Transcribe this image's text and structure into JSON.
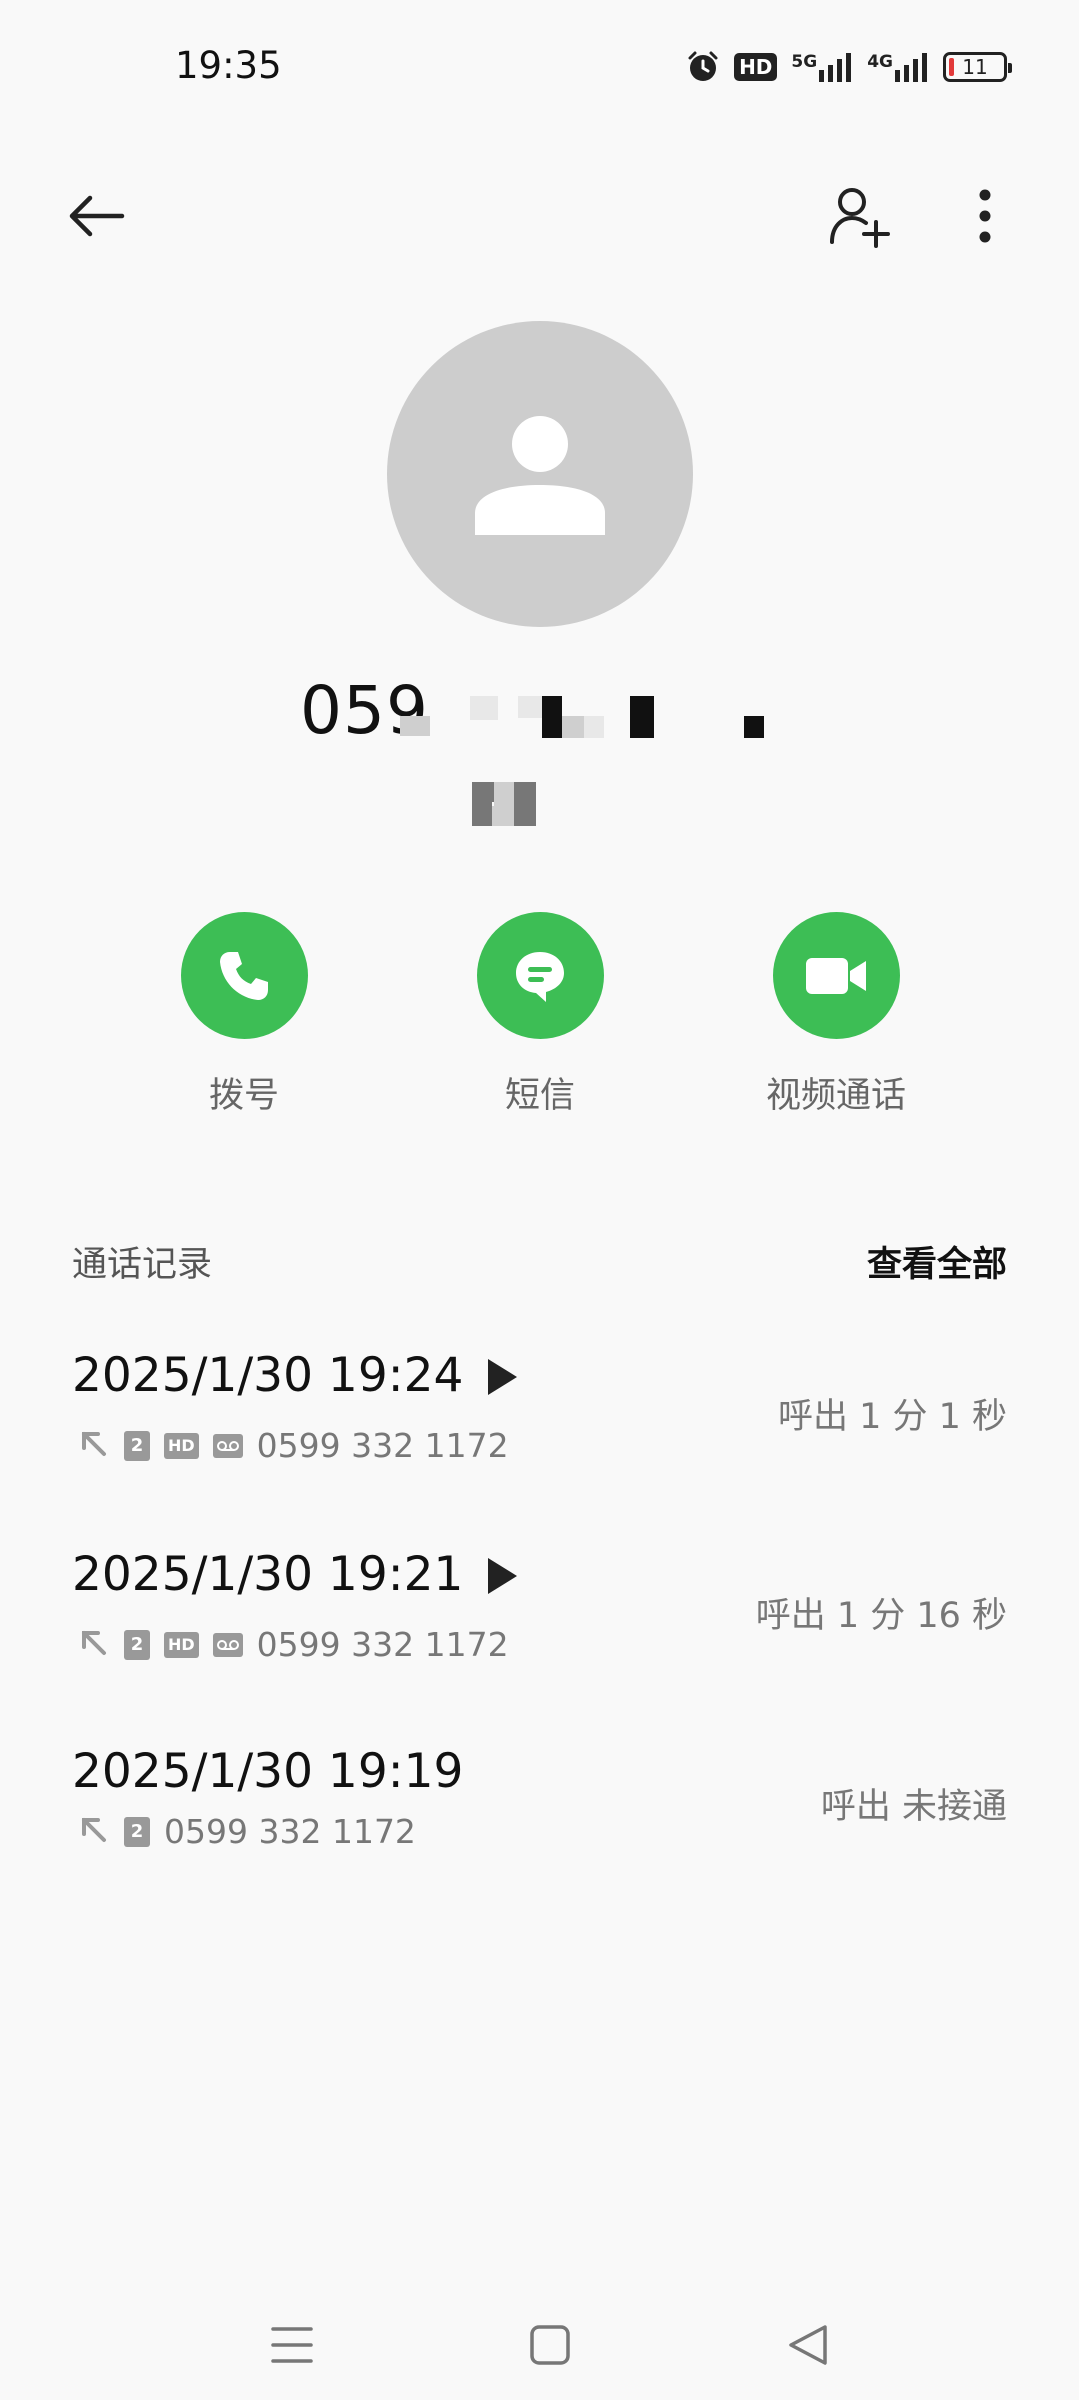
{
  "status_bar": {
    "time": "19:35",
    "hd_label": "HD",
    "net1_label": "5G",
    "net2_label": "4G",
    "battery_level": "11"
  },
  "top_bar": {
    "back_icon": "arrow-left-icon",
    "add_contact_icon": "person-add-icon",
    "more_icon": "more-vertical-icon"
  },
  "contact": {
    "number_visible": "059"
  },
  "actions": [
    {
      "label": "拨号",
      "icon": "phone-icon"
    },
    {
      "label": "短信",
      "icon": "message-icon"
    },
    {
      "label": "视频通话",
      "icon": "video-icon"
    }
  ],
  "call_log": {
    "title": "通话记录",
    "view_all": "查看全部",
    "entries": [
      {
        "datetime": "2025/1/30 19:24",
        "number": "0599 332 1172",
        "status": "呼出  1 分 1 秒",
        "has_recording": true,
        "hd": "HD",
        "sim": "2"
      },
      {
        "datetime": "2025/1/30 19:21",
        "number": "0599 332 1172",
        "status": "呼出  1 分 16 秒",
        "has_recording": true,
        "hd": "HD",
        "sim": "2"
      },
      {
        "datetime": "2025/1/30 19:19",
        "number": "0599 332 1172",
        "status": "呼出 未接通",
        "has_recording": false,
        "sim": "2"
      }
    ]
  },
  "colors": {
    "accent_green": "#3dbe55",
    "background": "#f9f9f9",
    "avatar_gray": "#cdcdcd"
  }
}
